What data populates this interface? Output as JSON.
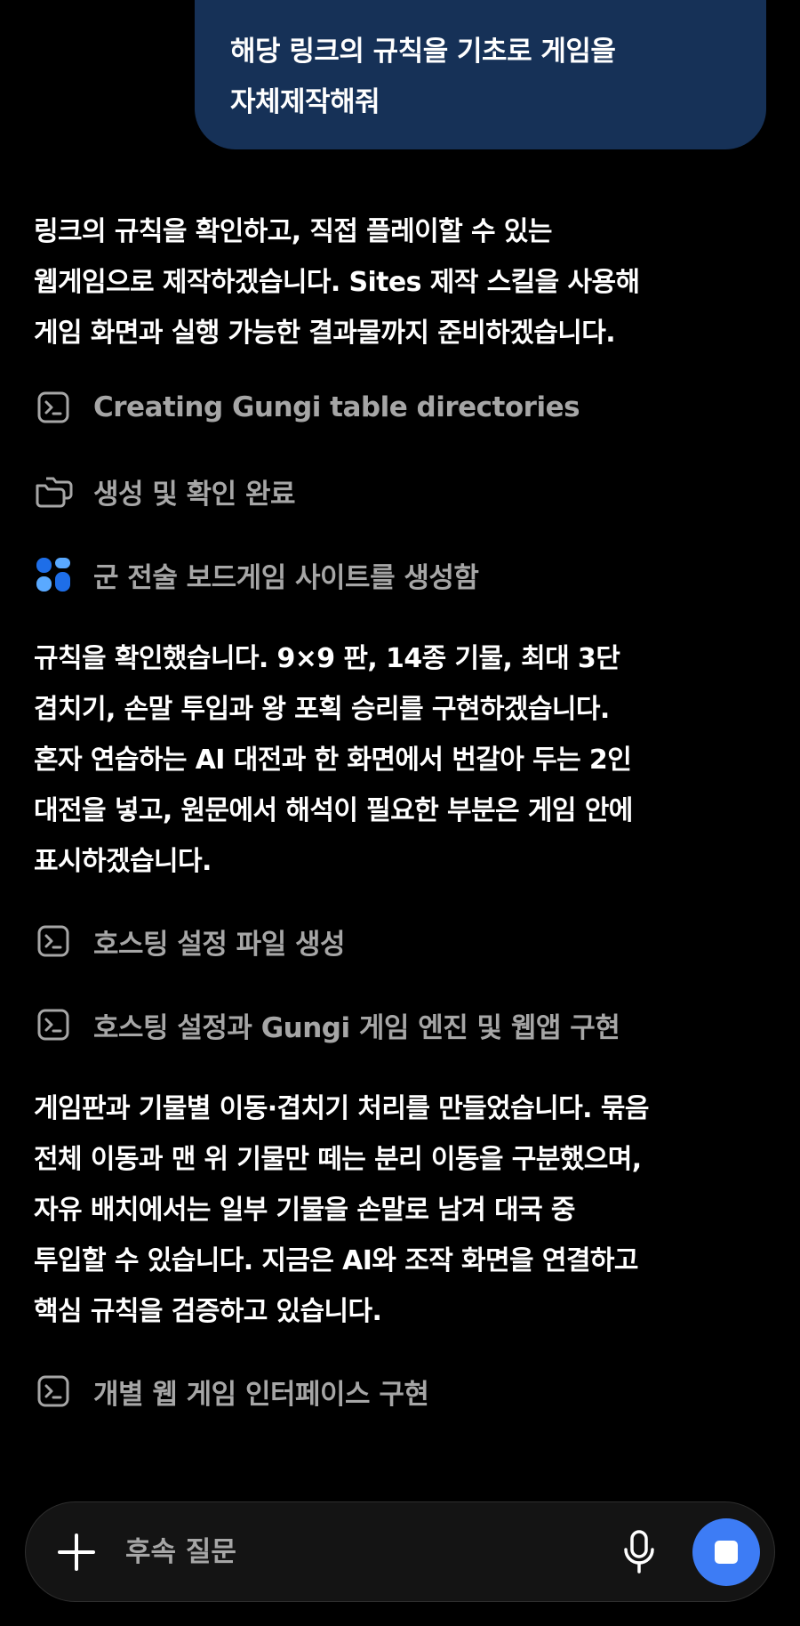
{
  "user_message": "해당 링크의 규칙을 기초로 게임을\n자체제작해줘",
  "paragraphs": [
    "링크의 규칙을 확인하고, 직접 플레이할 수 있는\n웹게임으로 제작하겠습니다. Sites 제작 스킬을 사용해\n게임 화면과 실행 가능한 결과물까지 준비하겠습니다.",
    "규칙을 확인했습니다. 9×9 판, 14종 기물, 최대 3단\n겹치기, 손말 투입과 왕 포획 승리를 구현하겠습니다.\n혼자 연습하는 AI 대전과 한 화면에서 번갈아 두는 2인\n대전을 넣고, 원문에서 해석이 필요한 부분은 게임 안에\n표시하겠습니다.",
    "게임판과 기물별 이동·겹치기 처리를 만들었습니다. 묶음\n전체 이동과 맨 위 기물만 떼는 분리 이동을 구분했으며,\n자유 배치에서는 일부 기물을 손말로 남겨 대국 중\n투입할 수 있습니다. 지금은 AI와 조작 화면을 연결하고\n핵심 규칙을 검증하고 있습니다."
  ],
  "steps": [
    {
      "icon": "terminal-icon",
      "label": "Creating Gungi table directories"
    },
    {
      "icon": "folders-icon",
      "label": "생성 및 확인 완료"
    },
    {
      "icon": "sites-icon",
      "label": "군 전술 보드게임 사이트를 생성함"
    },
    {
      "icon": "terminal-icon",
      "label": "호스팅 설정 파일 생성"
    },
    {
      "icon": "terminal-icon",
      "label": "호스팅 설정과 Gungi 게임 엔진 및 웹앱 구현"
    },
    {
      "icon": "terminal-icon",
      "label": "개별 웹 게임 인터페이스 구현"
    }
  ],
  "composer": {
    "placeholder": "후속 질문",
    "plus_icon": "plus-icon",
    "mic_icon": "microphone-icon",
    "stop_icon": "stop-icon"
  },
  "colors": {
    "background": "#000000",
    "user_bubble": "#163157",
    "muted_text": "#a6a6a6",
    "accent": "#3d7cf5"
  }
}
